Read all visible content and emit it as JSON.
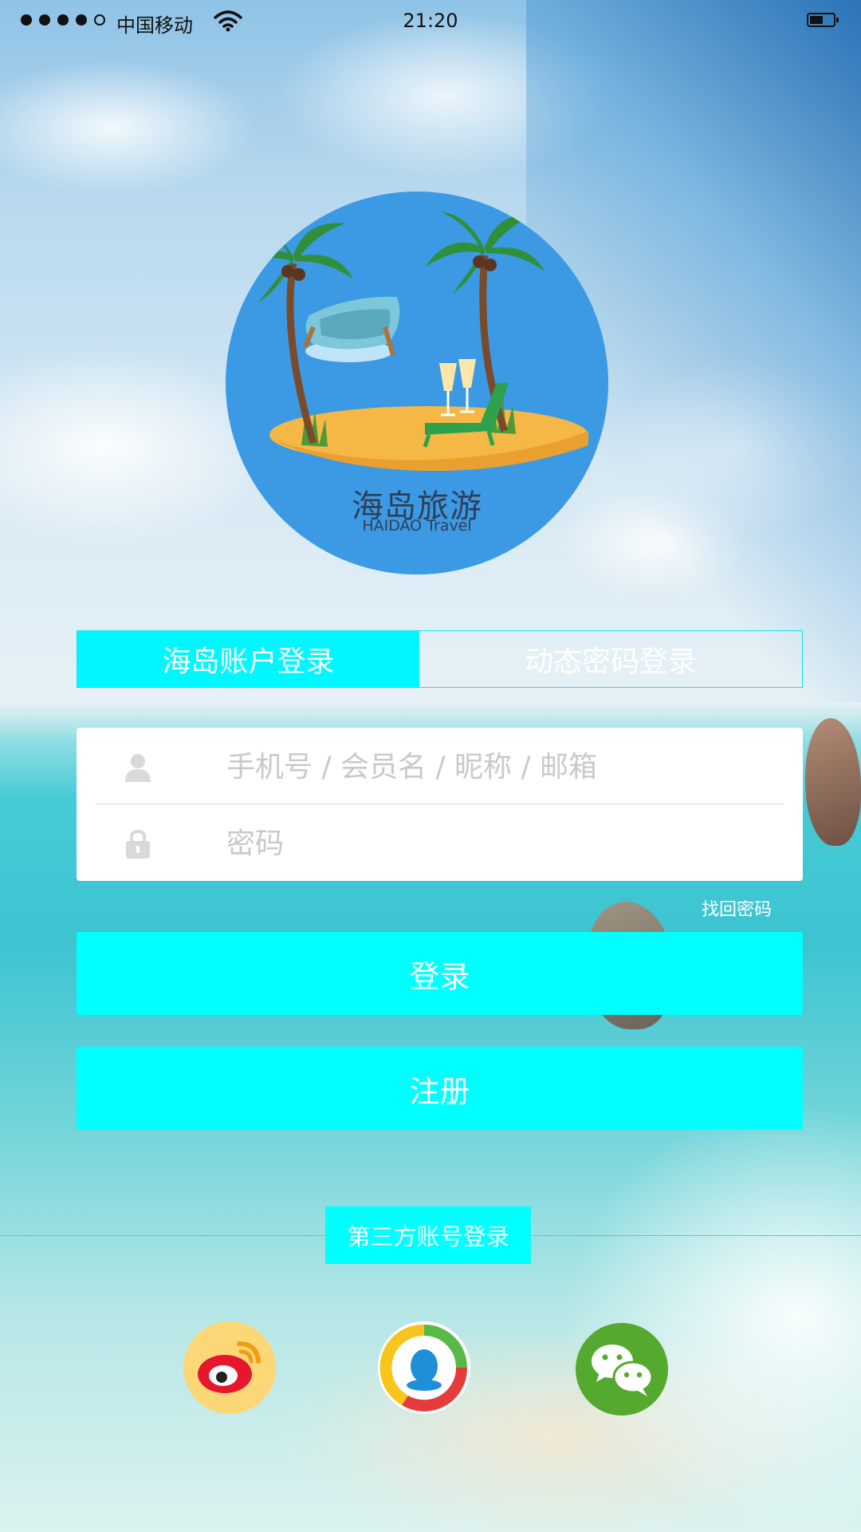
{
  "status_bar": {
    "carrier": "中国移动",
    "time": "21:20",
    "battery_level": 0.6,
    "signal_bars": 4
  },
  "logo": {
    "title_cn": "海岛旅游",
    "title_en": "HAIDAO Travel"
  },
  "login_tabs": {
    "account_login": "海岛账户登录",
    "dynamic_password_login": "动态密码登录",
    "active": "account_login"
  },
  "form": {
    "username_placeholder": "手机号 / 会员名 / 昵称 / 邮箱",
    "username_value": "",
    "password_placeholder": "密码",
    "password_value": ""
  },
  "forgot_password": "找回密码",
  "buttons": {
    "login": "登录",
    "register": "注册"
  },
  "third_party": {
    "label": "第三方账号登录",
    "providers": [
      "weibo-icon",
      "qq-icon",
      "wechat-icon"
    ]
  },
  "colors": {
    "accent": "#00ffff",
    "logo_bg": "#3b9ae3"
  }
}
